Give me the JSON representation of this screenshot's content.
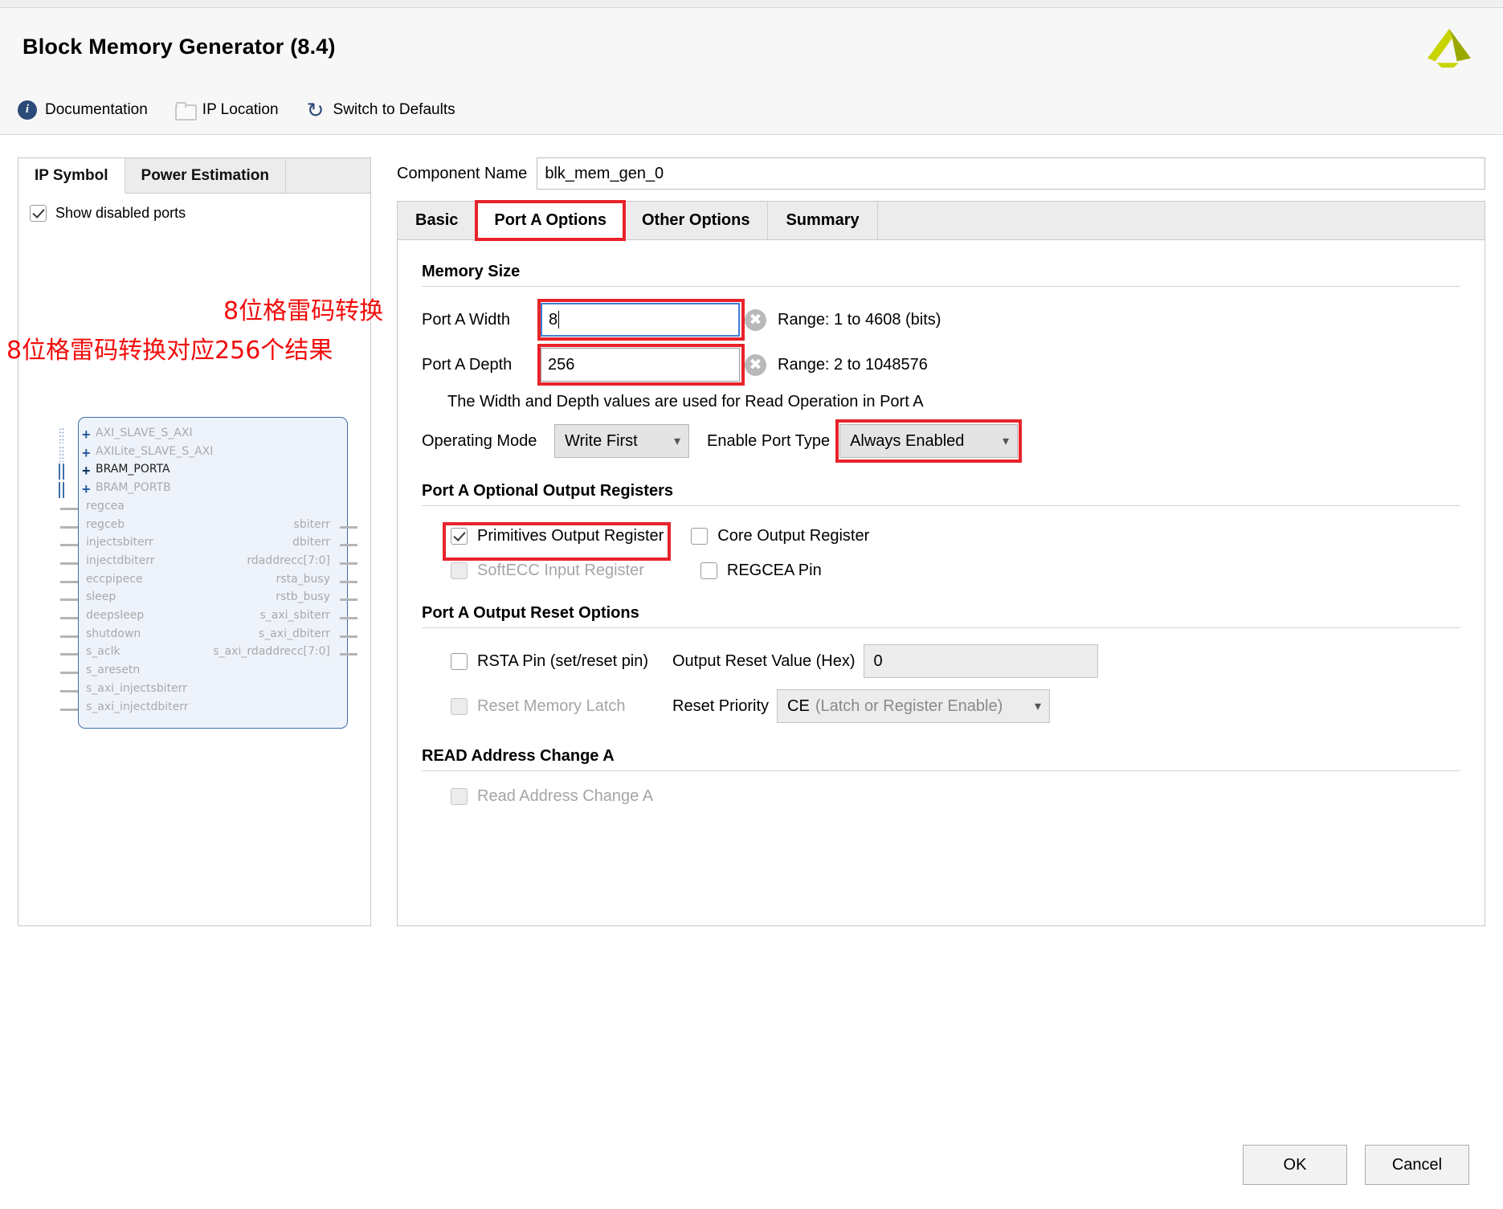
{
  "window": {
    "title": "Block Memory Generator (8.4)"
  },
  "toolbar": {
    "documentation": "Documentation",
    "ip_location": "IP Location",
    "switch_defaults": "Switch to Defaults"
  },
  "left_panel": {
    "tabs": [
      {
        "label": "IP Symbol",
        "active": true
      },
      {
        "label": "Power Estimation",
        "active": false
      }
    ],
    "show_disabled_ports": "Show disabled ports",
    "show_disabled_ports_checked": true,
    "symbol": {
      "buses": [
        {
          "name": "AXI_SLAVE_S_AXI",
          "enabled": false,
          "style": "dotted"
        },
        {
          "name": "AXILite_SLAVE_S_AXI",
          "enabled": false,
          "style": "dotted"
        },
        {
          "name": "BRAM_PORTA",
          "enabled": true,
          "style": "solid"
        },
        {
          "name": "BRAM_PORTB",
          "enabled": false,
          "style": "solid"
        }
      ],
      "inputs": [
        "regcea",
        "regceb",
        "injectsbiterr",
        "injectdbiterr",
        "eccpipece",
        "sleep",
        "deepsleep",
        "shutdown",
        "s_aclk",
        "s_aresetn",
        "s_axi_injectsbiterr",
        "s_axi_injectdbiterr"
      ],
      "outputs": [
        "sbiterr",
        "dbiterr",
        "rdaddrecc[7:0]",
        "rsta_busy",
        "rstb_busy",
        "s_axi_sbiterr",
        "s_axi_dbiterr",
        "s_axi_rdaddrecc[7:0]"
      ]
    }
  },
  "component": {
    "label": "Component Name",
    "value": "blk_mem_gen_0"
  },
  "tabs": [
    {
      "label": "Basic",
      "active": false,
      "highlight": false
    },
    {
      "label": "Port A Options",
      "active": true,
      "highlight": true
    },
    {
      "label": "Other Options",
      "active": false,
      "highlight": false
    },
    {
      "label": "Summary",
      "active": false,
      "highlight": false
    }
  ],
  "memory_size": {
    "section_title": "Memory Size",
    "width_label": "Port A Width",
    "width_value": "8",
    "width_range": "Range: 1 to 4608 (bits)",
    "depth_label": "Port A Depth",
    "depth_value": "256",
    "depth_range": "Range: 2 to 1048576",
    "hint": "The Width and Depth values are used for Read Operation in Port A",
    "operating_mode_label": "Operating Mode",
    "operating_mode_value": "Write First",
    "enable_port_type_label": "Enable Port Type",
    "enable_port_type_value": "Always Enabled"
  },
  "optional_output_registers": {
    "section_title": "Port A Optional Output Registers",
    "primitives": {
      "label": "Primitives Output Register",
      "checked": true,
      "disabled": false
    },
    "core": {
      "label": "Core Output Register",
      "checked": false,
      "disabled": false
    },
    "softecc": {
      "label": "SoftECC Input Register",
      "checked": false,
      "disabled": true
    },
    "regcea": {
      "label": "REGCEA Pin",
      "checked": false,
      "disabled": false
    }
  },
  "output_reset": {
    "section_title": "Port A Output Reset Options",
    "rsta_pin": {
      "label": "RSTA Pin (set/reset pin)",
      "checked": false,
      "disabled": false
    },
    "reset_value_label": "Output Reset Value (Hex)",
    "reset_value": "0",
    "reset_mem_latch": {
      "label": "Reset Memory Latch",
      "checked": false,
      "disabled": true
    },
    "reset_priority_label": "Reset Priority",
    "reset_priority_value": "CE",
    "reset_priority_suffix": "(Latch or Register Enable)"
  },
  "read_address_change": {
    "section_title": "READ Address Change A",
    "checkbox": {
      "label": "Read Address Change A",
      "checked": false,
      "disabled": true
    }
  },
  "footer": {
    "ok": "OK",
    "cancel": "Cancel"
  },
  "annotations": [
    {
      "text": "8位格雷码转换"
    },
    {
      "text": "8位格雷码转换对应256个结果"
    }
  ],
  "colors": {
    "accent_red": "#e8232a",
    "focus_blue": "#3d7fd4",
    "symbol_border": "#3f6ea8",
    "symbol_fill": "#eef3fb"
  }
}
